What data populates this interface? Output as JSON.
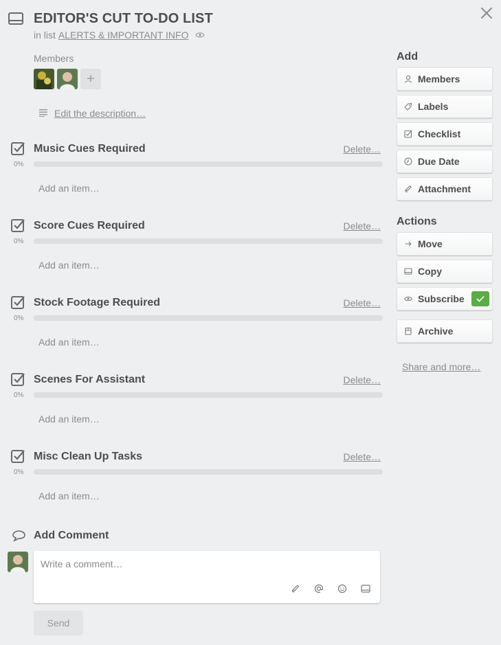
{
  "card": {
    "title": "EDITOR'S CUT TO-DO LIST",
    "in_list_prefix": "in list",
    "list_name": "ALERTS & IMPORTANT INFO"
  },
  "members": {
    "label": "Members",
    "add_symbol": "+"
  },
  "description": {
    "link": "Edit the description…"
  },
  "checklists": [
    {
      "title": "Music Cues Required",
      "delete": "Delete…",
      "percent": "0%",
      "progress": 0,
      "add_item": "Add an item…"
    },
    {
      "title": "Score Cues Required",
      "delete": "Delete…",
      "percent": "0%",
      "progress": 0,
      "add_item": "Add an item…"
    },
    {
      "title": "Stock Footage Required",
      "delete": "Delete…",
      "percent": "0%",
      "progress": 0,
      "add_item": "Add an item…"
    },
    {
      "title": "Scenes For Assistant",
      "delete": "Delete…",
      "percent": "0%",
      "progress": 0,
      "add_item": "Add an item…"
    },
    {
      "title": "Misc Clean Up Tasks",
      "delete": "Delete…",
      "percent": "0%",
      "progress": 0,
      "add_item": "Add an item…"
    }
  ],
  "comment": {
    "title": "Add Comment",
    "placeholder": "Write a comment…",
    "send": "Send"
  },
  "sidebar": {
    "add_heading": "Add",
    "add_buttons": [
      {
        "label": "Members",
        "icon": "person-icon"
      },
      {
        "label": "Labels",
        "icon": "tag-icon"
      },
      {
        "label": "Checklist",
        "icon": "checkbox-icon"
      },
      {
        "label": "Due Date",
        "icon": "clock-icon"
      },
      {
        "label": "Attachment",
        "icon": "paperclip-icon"
      }
    ],
    "actions_heading": "Actions",
    "action_buttons": [
      {
        "label": "Move",
        "icon": "arrow-right-icon"
      },
      {
        "label": "Copy",
        "icon": "card-icon"
      },
      {
        "label": "Subscribe",
        "icon": "eye-icon",
        "checked": true
      },
      {
        "label": "Archive",
        "icon": "archive-icon"
      }
    ],
    "share": "Share and more…"
  },
  "colors": {
    "background": "#edeff0",
    "accent_green": "#5aac44",
    "text": "#4d4d4d",
    "muted": "#8c8c8c"
  }
}
